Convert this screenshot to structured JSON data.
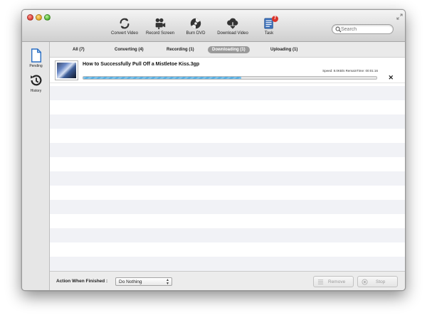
{
  "toolbar": {
    "items": [
      {
        "label": "Convert Video",
        "icon": "convert-icon"
      },
      {
        "label": "Record Screen",
        "icon": "camera-icon"
      },
      {
        "label": "Burn DVD",
        "icon": "disc-icon"
      },
      {
        "label": "Download Video",
        "icon": "cloud-download-icon"
      },
      {
        "label": "Task",
        "icon": "task-icon",
        "badge": "7"
      }
    ],
    "search_placeholder": "Search"
  },
  "sidebar": {
    "items": [
      {
        "label": "Pending",
        "icon": "document-icon"
      },
      {
        "label": "History",
        "icon": "history-icon"
      }
    ]
  },
  "tabs": [
    {
      "label": "All (7)",
      "active": false
    },
    {
      "label": "Converting (4)",
      "active": false
    },
    {
      "label": "Recording (1)",
      "active": false
    },
    {
      "label": "Downloading (1)",
      "active": true
    },
    {
      "label": "Uploading (1)",
      "active": false
    }
  ],
  "task": {
    "title": "How to Successfully Pull Off a Mistletoe Kiss.3gp",
    "speed_text": "Speed: 8.0KB/s RemainTime: 00:01:16",
    "progress": 0.54
  },
  "bottom": {
    "action_label": "Action When Finished :",
    "action_value": "Do Nothing",
    "remove_label": "Remove",
    "stop_label": "Stop"
  },
  "colors": {
    "progress_fill": "#5aaee0",
    "stripe": "#f1f2f6",
    "active_tab": "#9a9a9a",
    "badge": "#d9342b"
  }
}
